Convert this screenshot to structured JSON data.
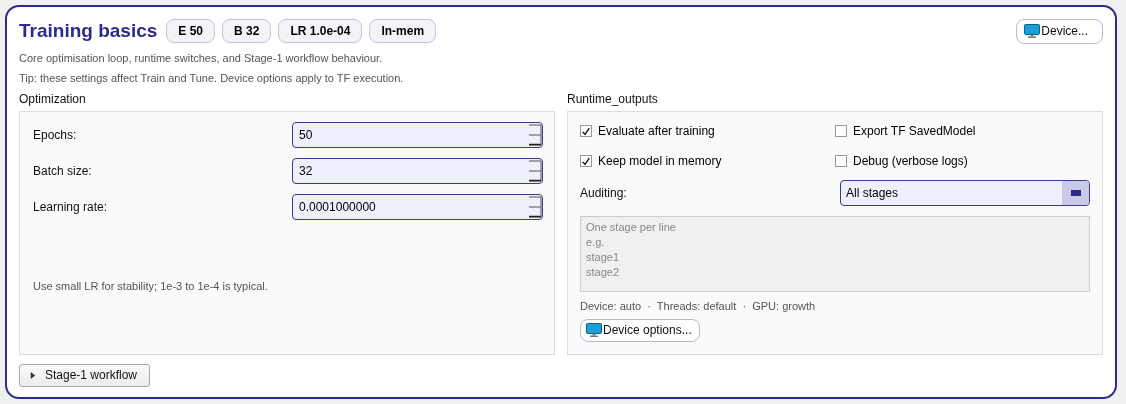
{
  "header": {
    "title": "Training basics",
    "chips": [
      "E 50",
      "B 32",
      "LR 1.0e-04",
      "In-mem"
    ],
    "device_button": "Device...",
    "subtitle": "Core optimisation loop, runtime switches, and Stage-1 workflow behaviour.",
    "tip": "Tip: these settings affect Train and Tune. Device options apply to TF execution."
  },
  "optimization": {
    "title": "Optimization",
    "fields": [
      {
        "label": "Epochs:",
        "value": "50"
      },
      {
        "label": "Batch size:",
        "value": "32"
      },
      {
        "label": "Learning rate:",
        "value": "0.0001000000"
      }
    ],
    "hint": "Use small LR for stability; 1e-3 to 1e-4 is typical."
  },
  "runtime": {
    "title": "Runtime_outputs",
    "checkboxes": [
      {
        "label": "Evaluate after training",
        "checked": true
      },
      {
        "label": "Export TF SavedModel",
        "checked": false
      },
      {
        "label": "Keep model in memory",
        "checked": true
      },
      {
        "label": "Debug (verbose logs)",
        "checked": false
      }
    ],
    "auditing": {
      "label": "Auditing:",
      "value": "All stages"
    },
    "stages_box": {
      "placeholder": "One stage per line\ne.g.\nstage1\nstage2"
    },
    "status": "Device: auto  ·  Threads: default  ·  GPU: growth",
    "device_options_button": "Device options..."
  },
  "stage1_workflow": {
    "label": "Stage-1 workflow",
    "expanded": false
  }
}
